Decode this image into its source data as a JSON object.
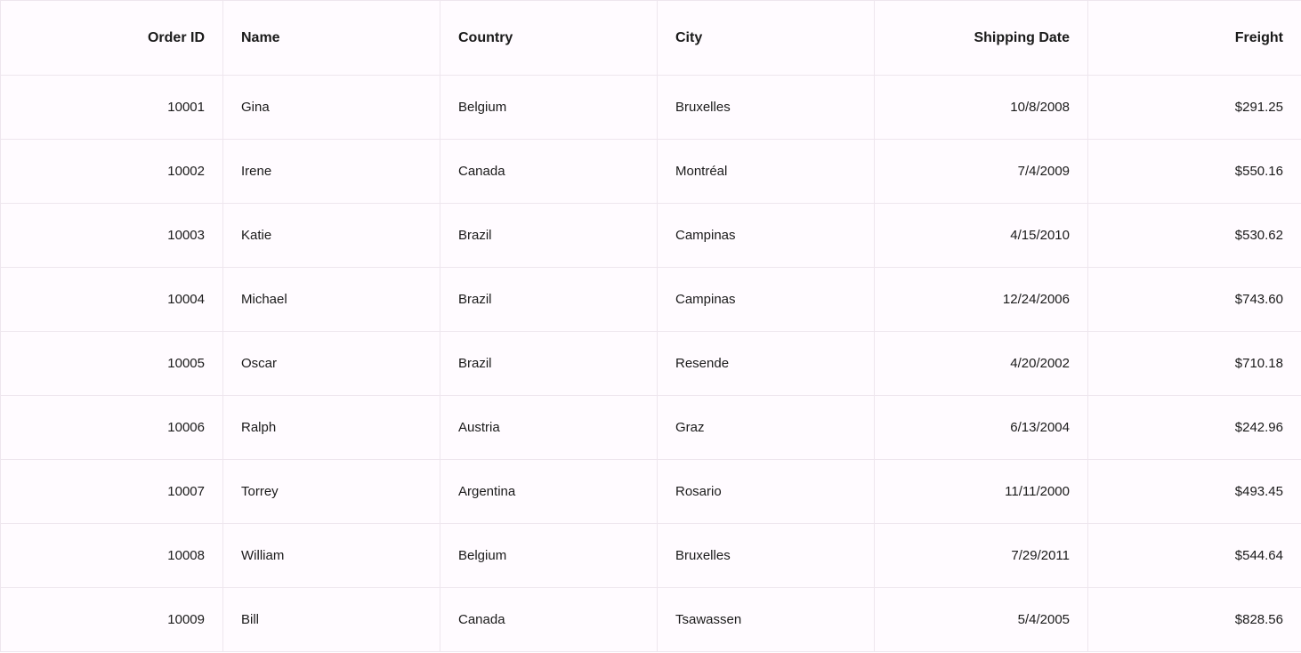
{
  "table": {
    "columns": [
      {
        "key": "order_id",
        "label": "Order ID",
        "align": "right"
      },
      {
        "key": "name",
        "label": "Name",
        "align": "left"
      },
      {
        "key": "country",
        "label": "Country",
        "align": "left"
      },
      {
        "key": "city",
        "label": "City",
        "align": "left"
      },
      {
        "key": "shipping_date",
        "label": "Shipping Date",
        "align": "right"
      },
      {
        "key": "freight",
        "label": "Freight",
        "align": "right"
      }
    ],
    "rows": [
      {
        "order_id": "10001",
        "name": "Gina",
        "country": "Belgium",
        "city": "Bruxelles",
        "shipping_date": "10/8/2008",
        "freight": "$291.25"
      },
      {
        "order_id": "10002",
        "name": "Irene",
        "country": "Canada",
        "city": "Montréal",
        "shipping_date": "7/4/2009",
        "freight": "$550.16"
      },
      {
        "order_id": "10003",
        "name": "Katie",
        "country": "Brazil",
        "city": "Campinas",
        "shipping_date": "4/15/2010",
        "freight": "$530.62"
      },
      {
        "order_id": "10004",
        "name": "Michael",
        "country": "Brazil",
        "city": "Campinas",
        "shipping_date": "12/24/2006",
        "freight": "$743.60"
      },
      {
        "order_id": "10005",
        "name": "Oscar",
        "country": "Brazil",
        "city": "Resende",
        "shipping_date": "4/20/2002",
        "freight": "$710.18"
      },
      {
        "order_id": "10006",
        "name": "Ralph",
        "country": "Austria",
        "city": "Graz",
        "shipping_date": "6/13/2004",
        "freight": "$242.96"
      },
      {
        "order_id": "10007",
        "name": "Torrey",
        "country": "Argentina",
        "city": "Rosario",
        "shipping_date": "11/11/2000",
        "freight": "$493.45"
      },
      {
        "order_id": "10008",
        "name": "William",
        "country": "Belgium",
        "city": "Bruxelles",
        "shipping_date": "7/29/2011",
        "freight": "$544.64"
      },
      {
        "order_id": "10009",
        "name": "Bill",
        "country": "Canada",
        "city": "Tsawassen",
        "shipping_date": "5/4/2005",
        "freight": "$828.56"
      }
    ]
  }
}
